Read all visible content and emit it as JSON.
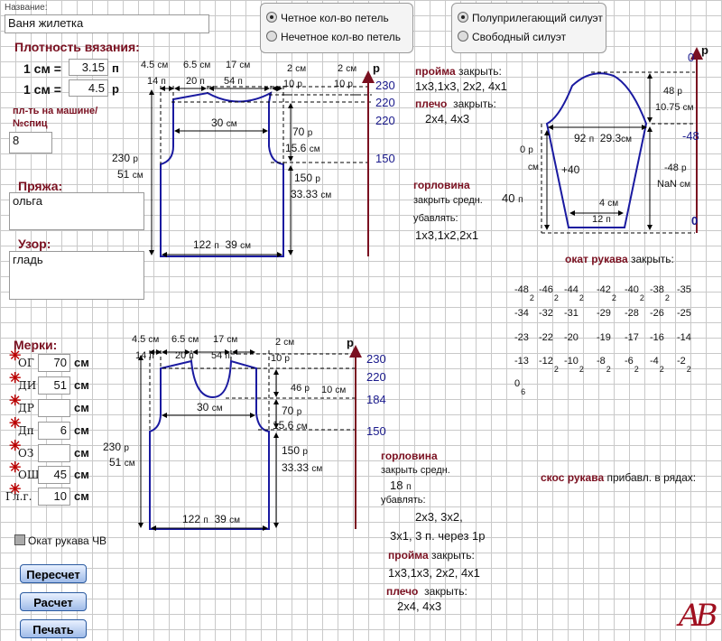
{
  "name_label": "Название:",
  "name_value": "Ваня жилетка",
  "density": {
    "title": "Плотность вязания:",
    "row1_label": "1 см =",
    "row1_value": "3.15",
    "row1_unit": "п",
    "row2_label": "1 см =",
    "row2_value": "4.5",
    "row2_unit": "р"
  },
  "machine": {
    "label1": "пл-ть на машине/",
    "label2": "№спиц",
    "value": "8"
  },
  "yarn": {
    "title": "Пряжа:",
    "value": "ольга"
  },
  "pattern": {
    "title": "Узор:",
    "value": "гладь"
  },
  "loops": {
    "even": "Четное кол-во петель",
    "odd": "Нечетное кол-во петель",
    "selected": "even"
  },
  "silhouette": {
    "semi": "Полуприлегающий силуэт",
    "free": "Свободный силуэт",
    "selected": "semi"
  },
  "measures": {
    "title": "Мерки:",
    "unit": "см",
    "items": [
      {
        "label": "ОГ",
        "value": "70"
      },
      {
        "label": "ДИ",
        "value": "51"
      },
      {
        "label": "ДР",
        "value": ""
      },
      {
        "label": "Дп",
        "value": "6"
      },
      {
        "label": "ОЗ",
        "value": ""
      },
      {
        "label": "ОШ",
        "value": "45"
      },
      {
        "label": "Гл.г.",
        "value": "10"
      }
    ]
  },
  "sleeve_cap_checkbox": "Окат рукава ЧВ",
  "buttons": {
    "recalc": "Пересчет",
    "calc": "Расчет",
    "print": "Печать"
  },
  "logo": "AB",
  "back": {
    "top_w1": "4.5",
    "top_w1_u": "см",
    "top_w2": "6.5",
    "top_w2_u": "см",
    "top_w3": "17",
    "top_w3_u": "см",
    "top_p1": "14",
    "top_p1_u": "п",
    "top_p2": "20",
    "top_p2_u": "п",
    "top_p3": "54",
    "top_p3_u": "п",
    "sh1": "2",
    "sh1_u": "см",
    "sh2": "2",
    "sh2_u": "см",
    "sh1p": "10",
    "sh1p_u": "р",
    "sh2p": "10",
    "sh2p_u": "р",
    "rows_label": "р",
    "r230": "230",
    "r220a": "220",
    "r220b": "220",
    "r150": "150",
    "mid_w": "30",
    "mid_w_u": "см",
    "arm_h": "70",
    "arm_h_u": "р",
    "arm_cm": "15.6",
    "arm_cm_u": "см",
    "low_h": "150",
    "low_h_u": "р",
    "low_cm": "33.33",
    "low_cm_u": "см",
    "total_h": "230",
    "total_h_u": "р",
    "total_cm": "51",
    "total_cm_u": "см",
    "bot_p": "122",
    "bot_p_u": "п",
    "bot_cm": "39",
    "bot_cm_u": "см"
  },
  "front": {
    "top_w1": "4.5",
    "top_w1_u": "см",
    "top_w2": "6.5",
    "top_w2_u": "см",
    "top_w3": "17",
    "top_w3_u": "см",
    "top_p1": "14",
    "top_p1_u": "п",
    "top_p2": "20",
    "top_p2_u": "п",
    "top_p3": "54",
    "top_p3_u": "п",
    "sh": "2",
    "sh_u": "см",
    "shp": "10",
    "shp_u": "р",
    "rows_label": "р",
    "r230": "230",
    "r220": "220",
    "r184": "184",
    "r150": "150",
    "neck_h": "46",
    "neck_h_u": "р",
    "neck_cm": "10",
    "neck_cm_u": "см",
    "mid_w": "30",
    "mid_w_u": "см",
    "arm_h": "70",
    "arm_h_u": "р",
    "arm_cm": "15.6",
    "arm_cm_u": "см",
    "low_h": "150",
    "low_h_u": "р",
    "low_cm": "33.33",
    "low_cm_u": "см",
    "total_h": "230",
    "total_h_u": "р",
    "total_cm": "51",
    "total_cm_u": "см",
    "bot_p": "122",
    "bot_p_u": "п",
    "bot_cm": "39",
    "bot_cm_u": "см"
  },
  "back_instr": {
    "armhole_title": "пройма",
    "armhole_close": "закрыть:",
    "armhole_seq": "1х3,1х3,  2х2,  4х1",
    "shoulder_title": "плечо",
    "shoulder_close": "закрыть:",
    "shoulder_seq": "2х4,  4х3",
    "neck_title": "горловина",
    "neck_close": "закрыть средн.",
    "neck_val": "40",
    "neck_val_u": "п",
    "neck_dec": "убавлять:",
    "neck_seq": "1х3,1х2,2х1"
  },
  "front_instr": {
    "neck_title": "горловина",
    "neck_close": "закрыть средн.",
    "neck_val": "18",
    "neck_val_u": "п",
    "neck_dec": "убавлять:",
    "neck_seq1": "2х3,  3х2,",
    "neck_seq2": "3х1,  3 п. через 1р",
    "armhole_title": "пройма",
    "armhole_close": "закрыть:",
    "armhole_seq": "1х3,1х3,  2х2,  4х1",
    "shoulder_title": "плечо",
    "shoulder_close": "закрыть:",
    "shoulder_seq": "2х4,  4х3"
  },
  "sleeve": {
    "top_rows": "0",
    "top_rows_u": "р",
    "cap_h": "48",
    "cap_h_u": "р",
    "cap_cm": "10.75",
    "cap_cm_u": "см",
    "w_p": "92",
    "w_p_u": "п",
    "w_cm": "29.3",
    "w_cm_u": "см",
    "r_m48": "-48",
    "left_h": "0",
    "left_h_u": "р",
    "left_cm_u": "см",
    "plus40": "+40",
    "rh": "-48",
    "rh_u": "р",
    "rh_cm": "NaN",
    "rh_cm_u": "см",
    "bot_cm": "4",
    "bot_cm_u": "см",
    "bot_p": "12",
    "bot_p_u": "п",
    "r_zero": "0"
  },
  "cap": {
    "title": "окат рукава",
    "close": "закрыть:",
    "rows": [
      [
        {
          "v": "-48",
          "s": "2"
        },
        {
          "v": "-46",
          "s": "2"
        },
        {
          "v": "-44",
          "s": "2"
        },
        {
          "v": "-42",
          "s": "2"
        },
        {
          "v": "-40",
          "s": "2"
        },
        {
          "v": "-38",
          "s": "2"
        },
        {
          "v": "-35",
          "s": ""
        }
      ],
      [
        {
          "v": "-34",
          "s": ""
        },
        {
          "v": "-32",
          "s": ""
        },
        {
          "v": "-31",
          "s": ""
        },
        {
          "v": "-29",
          "s": ""
        },
        {
          "v": "-28",
          "s": ""
        },
        {
          "v": "-26",
          "s": ""
        },
        {
          "v": "-25",
          "s": ""
        }
      ],
      [
        {
          "v": "-23",
          "s": ""
        },
        {
          "v": "-22",
          "s": ""
        },
        {
          "v": "-20",
          "s": ""
        },
        {
          "v": "-19",
          "s": ""
        },
        {
          "v": "-17",
          "s": ""
        },
        {
          "v": "-16",
          "s": ""
        },
        {
          "v": "-14",
          "s": ""
        }
      ],
      [
        {
          "v": "-13",
          "s": ""
        },
        {
          "v": "-12",
          "s": "2"
        },
        {
          "v": "-10",
          "s": "2"
        },
        {
          "v": "-8",
          "s": "2"
        },
        {
          "v": "-6",
          "s": "2"
        },
        {
          "v": "-4",
          "s": "2"
        },
        {
          "v": "-2",
          "s": "2"
        }
      ],
      [
        {
          "v": "0",
          "s": "6"
        }
      ]
    ]
  },
  "sleeve_slope": {
    "title": "скос рукава",
    "text": "прибавл. в рядах:"
  }
}
